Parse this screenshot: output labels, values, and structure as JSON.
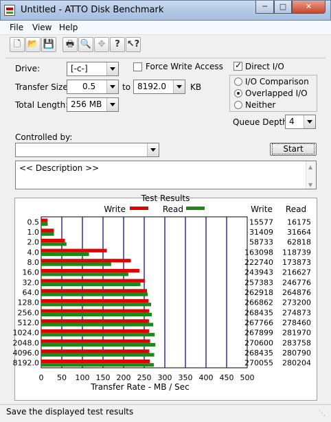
{
  "window": {
    "title": "Untitled - ATTO Disk Benchmark"
  },
  "menu": {
    "items": [
      "File",
      "View",
      "Help"
    ]
  },
  "toolbar": {
    "icons": [
      "new-document-icon",
      "open-folder-icon",
      "save-icon",
      "print-icon",
      "print-preview-icon",
      "move-icon",
      "help-icon",
      "context-help-icon"
    ]
  },
  "form": {
    "drive_label": "Drive:",
    "drive_value": "[-c-]",
    "force_write_label": "Force Write Access",
    "force_write_checked": false,
    "direct_io_label": "Direct I/O",
    "direct_io_checked": true,
    "transfer_size_label": "Transfer Size:",
    "transfer_from": "0.5",
    "to_label": "to",
    "transfer_to": "8192.0",
    "kb_label": "KB",
    "total_length_label": "Total Length:",
    "total_length_value": "256 MB",
    "io_options": [
      "I/O Comparison",
      "Overlapped I/O",
      "Neither"
    ],
    "io_selected": "Overlapped I/O",
    "queue_depth_label": "Queue Depth:",
    "queue_depth_value": "4",
    "controlled_by_label": "Controlled by:",
    "controlled_by_value": "",
    "start_label": "Start",
    "description_text": "<< Description >>"
  },
  "results": {
    "title": "Test Results",
    "legend_write": "Write",
    "legend_read": "Read",
    "col_write": "Write",
    "col_read": "Read",
    "colors": {
      "write": "#e00000",
      "read": "#1a8a1a",
      "grid": "#1f1f9e"
    }
  },
  "chart_data": {
    "type": "bar",
    "orientation": "horizontal",
    "xlabel": "Transfer Rate - MB / Sec",
    "xlim": [
      0,
      500
    ],
    "xticks": [
      0,
      50,
      100,
      150,
      200,
      250,
      300,
      350,
      400,
      450,
      500
    ],
    "categories": [
      "0.5",
      "1.0",
      "2.0",
      "4.0",
      "8.0",
      "16.0",
      "32.0",
      "64.0",
      "128.0",
      "256.0",
      "512.0",
      "1024.0",
      "2048.0",
      "4096.0",
      "8192.0"
    ],
    "series": [
      {
        "name": "Write",
        "values": [
          15577,
          31409,
          58733,
          163098,
          222740,
          243943,
          257383,
          262918,
          266862,
          268435,
          267766,
          267899,
          270600,
          268435,
          270055
        ]
      },
      {
        "name": "Read",
        "values": [
          16175,
          31664,
          62818,
          118739,
          173873,
          216627,
          246776,
          264876,
          273200,
          274873,
          278460,
          281970,
          283758,
          280790,
          280204
        ]
      }
    ]
  },
  "status": {
    "text": "Save the displayed test results"
  }
}
